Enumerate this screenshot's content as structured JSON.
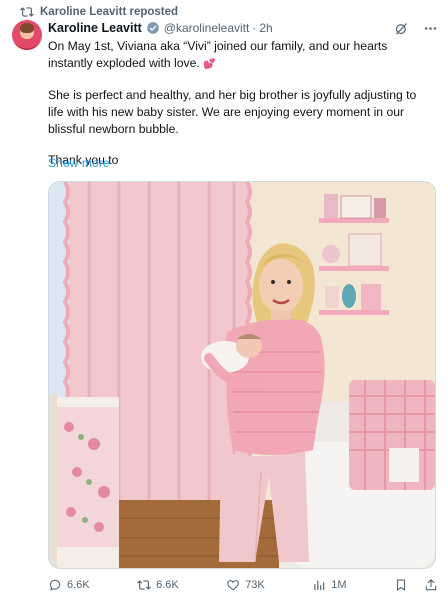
{
  "repost": {
    "label": "Karoline Leavitt reposted"
  },
  "author": {
    "name": "Karoline Leavitt",
    "handle": "@karolineleavitt",
    "separator": "·",
    "time": "2h"
  },
  "tweet": {
    "paragraph_1": "On May 1st, Viviana aka “Vivi” joined our family, and our hearts instantly exploded with love. ",
    "heart_emoji": "💕",
    "paragraph_2": "She is perfect and healthy, and her big brother is joyfully adjusting to life with his new baby sister. We are enjoying every moment in our blissful newborn bubble.",
    "paragraph_3": "Thank you to",
    "show_more": "Show more"
  },
  "stats": {
    "replies": "6.6K",
    "reposts": "6.6K",
    "likes": "73K",
    "views": "1M"
  },
  "colors": {
    "link": "#1d9bf0",
    "muted": "#536471",
    "verified": "#829aab"
  }
}
